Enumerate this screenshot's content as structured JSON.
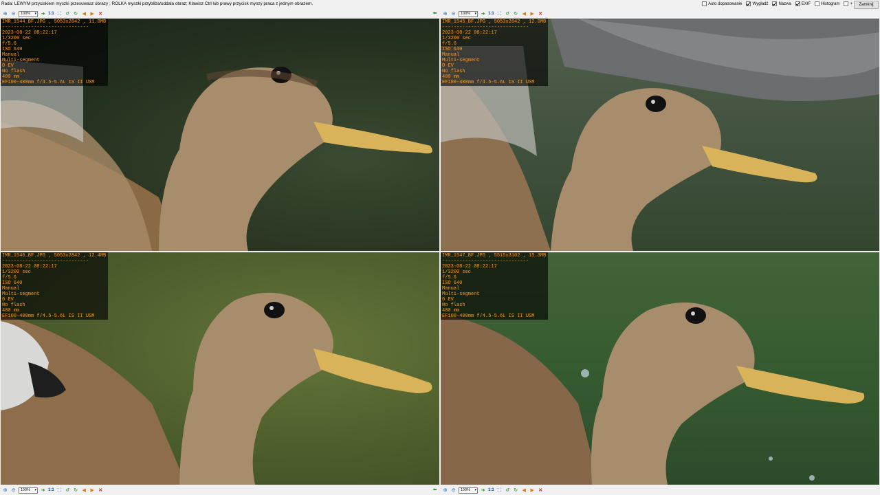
{
  "hint": "Rada: LEWYM przyciskiem myszki przesuwasz obrazy ; ROLKA myszki przybliża/oddala obraz; Klawisz Ctrl lub prawy przycisk myszy praca z jednym obrazem.",
  "options": [
    {
      "label": "Auto dopasowanie",
      "checked": false
    },
    {
      "label": "Wygładź",
      "checked": true
    },
    {
      "label": "Nazwa",
      "checked": true
    },
    {
      "label": "EXIF",
      "checked": true
    },
    {
      "label": "Histogram",
      "checked": false
    },
    {
      "label": "+",
      "checked": false
    }
  ],
  "close_label": "Zamknij",
  "toolbar": {
    "zoom": "100%",
    "ratio": "1:1"
  },
  "exif_separator": "------------------------------",
  "panels": [
    {
      "filename": "IMR_1544_BF.JPG , 5053x2842 , 11.8MB",
      "date": "2023-08-22 08:22:17",
      "shutter": "1/3200 sec",
      "aperture": "f/5.6",
      "iso": "ISO 640",
      "mode": "Manual",
      "metering": "Multi-segment",
      "ev": "0 EV",
      "flash": "No flash",
      "focal": "400 mm",
      "lens": "EF100-400mm f/4.5-5.6L IS II USM"
    },
    {
      "filename": "IMR_1545_BF.JPG , 5053x2842 , 12.0MB",
      "date": "2023-08-22 08:22:17",
      "shutter": "1/3200 sec",
      "aperture": "f/5.6",
      "iso": "ISO 640",
      "mode": "Manual",
      "metering": "Multi-segment",
      "ev": "0 EV",
      "flash": "No flash",
      "focal": "400 mm",
      "lens": "EF100-400mm f/4.5-5.6L IS II USM"
    },
    {
      "filename": "IMR_1546_BF.JPG , 5053x2842 , 12.4MB",
      "date": "2023-08-22 08:22:17",
      "shutter": "1/3200 sec",
      "aperture": "f/5.6",
      "iso": "ISO 640",
      "mode": "Manual",
      "metering": "Multi-segment",
      "ev": "0 EV",
      "flash": "No flash",
      "focal": "400 mm",
      "lens": "EF100-400mm f/4.5-5.6L IS II USM"
    },
    {
      "filename": "IMR_1547_BF.JPG , 5515x3102 , 15.3MB",
      "date": "2023-08-22 08:22:17",
      "shutter": "1/3200 sec",
      "aperture": "f/5.6",
      "iso": "ISO 640",
      "mode": "Manual",
      "metering": "Multi-segment",
      "ev": "0 EV",
      "flash": "No flash",
      "focal": "400 mm",
      "lens": "EF100-400mm f/4.5-5.6L IS II USM"
    }
  ],
  "colors": {
    "exif_text": "#ff9820",
    "exif_bg": "#000000"
  },
  "icons": [
    "zoom-in-icon",
    "zoom-out-icon",
    "next-arrow-icon",
    "fit-icon",
    "rotate-left-icon",
    "rotate-right-icon",
    "prev-image-icon",
    "next-image-icon",
    "close-icon",
    "back-arrow-icon"
  ]
}
